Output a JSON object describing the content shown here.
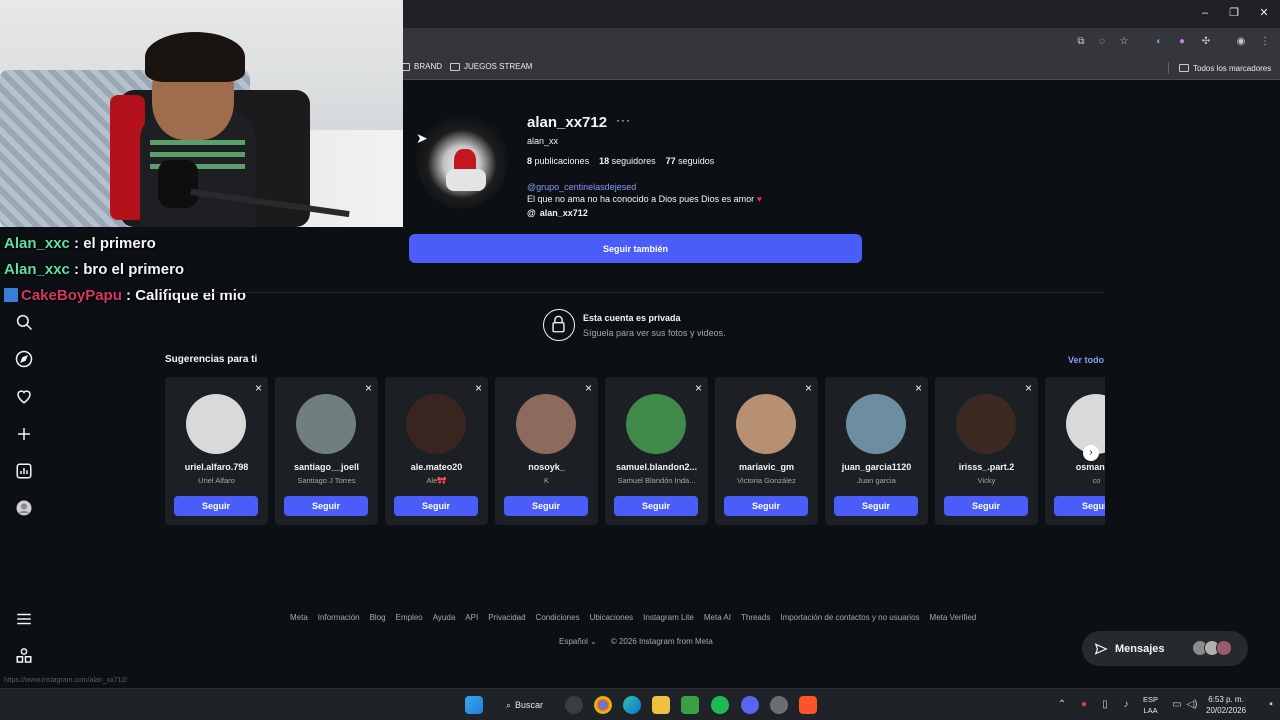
{
  "browser": {
    "bookmarks": [
      {
        "label": "BRAND"
      },
      {
        "label": "JUEGOS STREAM"
      }
    ],
    "all_bookmarks": "Todos los marcadores",
    "status_url": "https://www.instagram.com/alan_xx712/"
  },
  "stream_chat": [
    {
      "user": "Alan_xxc",
      "message": ": el primero",
      "color": "#5ee0a0"
    },
    {
      "user": "Alan_xxc",
      "message": ": bro el primero",
      "color": "#5ee0a0"
    },
    {
      "user": "CakeBoyPapu",
      "message": ": Califique el mio",
      "color": "#d63864"
    }
  ],
  "profile": {
    "username": "alan_xx712",
    "more": "···",
    "full_name": "alan_xx",
    "posts_count": "8",
    "posts_label": "publicaciones",
    "followers_count": "18",
    "followers_label": "seguidores",
    "following_count": "77",
    "following_label": "seguidos",
    "bio_link": "@grupo_centinelasdejesed",
    "bio_text": "El que no ama no ha conocido a Dios pues Dios es amor",
    "bio_emoji": "♥",
    "threads_handle": "alan_xx712",
    "follow_back_label": "Seguir también"
  },
  "private": {
    "title": "Esta cuenta es privada",
    "subtitle": "Síguela para ver sus fotos y videos."
  },
  "suggestions": {
    "title": "Sugerencias para ti",
    "see_all": "Ver todo",
    "follow_label": "Seguir",
    "close_icon": "×",
    "items": [
      {
        "username": "uriel.alfaro.798",
        "name": "Uriel Alfaro",
        "avatar_color": "#d9d9d9"
      },
      {
        "username": "santiago__joell",
        "name": "Santiago J Torres",
        "avatar_color": "#6f7f80"
      },
      {
        "username": "ale.mateo20",
        "name": "Ale🎀",
        "avatar_color": "#3a2420"
      },
      {
        "username": "nosoyk_",
        "name": "K",
        "avatar_color": "#8c6a5c"
      },
      {
        "username": "samuel.blandon2...",
        "name": "Samuel Blandón Inda...",
        "avatar_color": "#3f8a4a"
      },
      {
        "username": "mariavic_gm",
        "name": "Victoria González",
        "avatar_color": "#b69070"
      },
      {
        "username": "juan_garcia1120",
        "name": "Juan garcia",
        "avatar_color": "#6d8ea0"
      },
      {
        "username": "irisss_.part.2",
        "name": "Vicky",
        "avatar_color": "#3b2a22"
      },
      {
        "username": "osman_al",
        "name": "co",
        "avatar_color": "#d9d9d9"
      }
    ]
  },
  "footer": {
    "links": [
      "Meta",
      "Información",
      "Blog",
      "Empleo",
      "Ayuda",
      "API",
      "Privacidad",
      "Condiciones",
      "Ubicaciones",
      "Instagram Lite",
      "Meta AI",
      "Threads",
      "Importación de contactos y no usuarios",
      "Meta Verified"
    ],
    "language": "Español",
    "copyright": "© 2026 Instagram from Meta"
  },
  "messages_label": "Mensajes",
  "taskbar": {
    "search_label": "Buscar",
    "lang_top": "ESP",
    "lang_bottom": "LAA",
    "time": "6:53 p. m.",
    "date": "20/02/2026"
  }
}
